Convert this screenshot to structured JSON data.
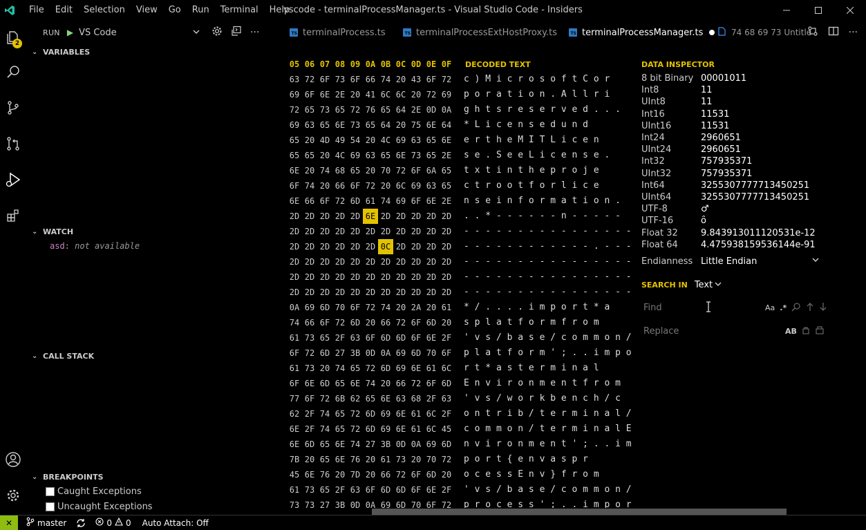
{
  "window": {
    "title": "vscode - terminalProcessManager.ts - Visual Studio Code - Insiders",
    "menu": [
      "File",
      "Edit",
      "Selection",
      "View",
      "Go",
      "Run",
      "Terminal",
      "Help"
    ],
    "controls": [
      "minimize-icon",
      "maximize-icon",
      "close-icon"
    ]
  },
  "activity": {
    "explorer_badge": "2",
    "icons": [
      "files-icon",
      "search-icon",
      "source-control-icon",
      "pull-request-icon",
      "run-debug-icon",
      "extensions-icon",
      "account-icon",
      "settings-gear-icon"
    ]
  },
  "sidebar": {
    "run_label": "RUN",
    "config": "VS Code",
    "variables": "VARIABLES",
    "watch": "WATCH",
    "watch_expr": "asd:",
    "watch_value": "not available",
    "call_stack": "CALL STACK",
    "breakpoints": "BREAKPOINTS",
    "bp_items": [
      "Caught Exceptions",
      "Uncaught Exceptions"
    ]
  },
  "tabs": [
    {
      "label": "terminalProcess.ts"
    },
    {
      "label": "terminalProcessExtHostProxy.ts"
    },
    {
      "label": "terminalProcessManager.ts"
    },
    {
      "label": "74 68 69 73 Untitle"
    }
  ],
  "hex": {
    "columns": [
      "05",
      "06",
      "07",
      "08",
      "09",
      "0A",
      "0B",
      "0C",
      "0D",
      "0E",
      "0F"
    ],
    "decoded_header": "DECODED TEXT",
    "rows": [
      "63 72 6F 73 6F 66 74 20 43 6F 72",
      "69 6F 6E 2E 20 41 6C 6C 20 72 69",
      "72 65 73 65 72 76 65 64 2E 0D 0A",
      "69 63 65 6E 73 65 64 20 75 6E 64",
      "65 20 4D 49 54 20 4C 69 63 65 6E",
      "65 65 20 4C 69 63 65 6E 73 65 2E",
      "6E 20 74 68 65 20 70 72 6F 6A 65",
      "6F 74 20 66 6F 72 20 6C 69 63 65",
      "6E 66 6F 72 6D 61 74 69 6F 6E 2E",
      "2D 2D 2D 2D 2D 6E 2D 2D 2D 2D 2D",
      "2D 2D 2D 2D 2D 2D 2D 2D 2D 2D 2D",
      "2D 2D 2D 2D 2D 2D 0C 2D 2D 2D 2D",
      "2D 2D 2D 2D 2D 2D 2D 2D 2D 2D 2D",
      "2D 2D 2D 2D 2D 2D 2D 2D 2D 2D 2D",
      "2D 2D 2D 2D 2D 2D 2D 2D 2D 2D 2D",
      "0A 69 6D 70 6F 72 74 20 2A 20 61",
      "74 66 6F 72 6D 20 66 72 6F 6D 20",
      "61 73 65 2F 63 6F 6D 6D 6F 6E 2F",
      "6F 72 6D 27 3B 0D 0A 69 6D 70 6F",
      "61 73 20 74 65 72 6D 69 6E 61 6C",
      "6F 6E 6D 65 6E 74 20 66 72 6F 6D",
      "77 6F 72 6B 62 65 6E 63 68 2F 63",
      "62 2F 74 65 72 6D 69 6E 61 6C 2F",
      "6E 2F 74 65 72 6D 69 6E 61 6C 45",
      "6E 6D 65 6E 74 27 3B 0D 0A 69 6D",
      "7B 20 65 6E 76 20 61 73 20 70 72",
      "45 6E 76 20 7D 20 66 72 6F 6D 20",
      "61 73 65 2F 63 6F 6D 6D 6F 6E 2F",
      "73 73 27 3B 0D 0A 69 6D 70 6F 72"
    ],
    "decoded": [
      "c ) M i c r o s o f t C o r",
      "p o r a t i o n . A l l r i",
      "g h t s r e s e r v e d . . .",
      "* L i c e n s e d u n d",
      "e r t h e M I T L i c e n",
      "s e . S e e L i c e n s e .",
      "t x t i n t h e p r o j e",
      "c t r o o t f o r l i c e",
      "n s e i n f o r m a t i o n .",
      ". . * - - - - - - n - - - - -",
      "- - - - - - - - - - - - - - - -",
      "- - - - - - - - - - - - . - - - -",
      "- - - - - - - - - - - - - - - -",
      "- - - - - - - - - - - - - - - -",
      "- - - - - - - - - - - - - - - -",
      "* / . . . . i m p o r t * a",
      "s p l a t f o r m f r o m",
      "' v s / b a s e / c o m m o n /",
      "p l a t f o r m ' ; . . i m p o",
      "r t * a s t e r m i n a l",
      "E n v i r o n m e n t f r o m",
      "' v s / w o r k b e n c h / c",
      "o n t r i b / t e r m i n a l /",
      "c o m m o n / t e r m i n a l E",
      "n v i r o n m e n t ' ; . . i m",
      "p o r t { e n v a s p r",
      "o c e s s E n v } f r o m",
      "' v s / b a s e / c o m m o n /",
      "p r o c e s s ' ; . . i m p o r"
    ]
  },
  "inspector": {
    "title": "DATA INSPECTOR",
    "rows": [
      {
        "label": "8 bit Binary",
        "value": "00001011"
      },
      {
        "label": "Int8",
        "value": "11"
      },
      {
        "label": "UInt8",
        "value": "11"
      },
      {
        "label": "Int16",
        "value": "11531"
      },
      {
        "label": "UInt16",
        "value": "11531"
      },
      {
        "label": "Int24",
        "value": "2960651"
      },
      {
        "label": "UInt24",
        "value": "2960651"
      },
      {
        "label": "Int32",
        "value": "757935371"
      },
      {
        "label": "UInt32",
        "value": "757935371"
      },
      {
        "label": "Int64",
        "value": "3255307777713450251"
      },
      {
        "label": "UInt64",
        "value": "3255307777713450251"
      },
      {
        "label": "UTF-8",
        "value": "♂"
      },
      {
        "label": "UTF-16",
        "value": "ȏ"
      },
      {
        "label": "Float 32",
        "value": "9.843913011120531e-12"
      },
      {
        "label": "Float 64",
        "value": "4.475938159536144e-91"
      }
    ],
    "endianness_label": "Endianness",
    "endianness_value": "Little Endian",
    "search_in_label": "SEARCH IN",
    "search_in_value": "Text",
    "find_placeholder": "Find",
    "replace_placeholder": "Replace",
    "find_match_case": "Aa",
    "find_regex": ".*",
    "replace_all": "AB"
  },
  "status": {
    "branch": "master",
    "errors": "0",
    "warnings": "0",
    "auto_attach": "Auto Attach: Off"
  },
  "colors": {
    "accent": "#e3c300",
    "remote": "#8fbc10",
    "ts_badge": "#2f7ac4"
  }
}
